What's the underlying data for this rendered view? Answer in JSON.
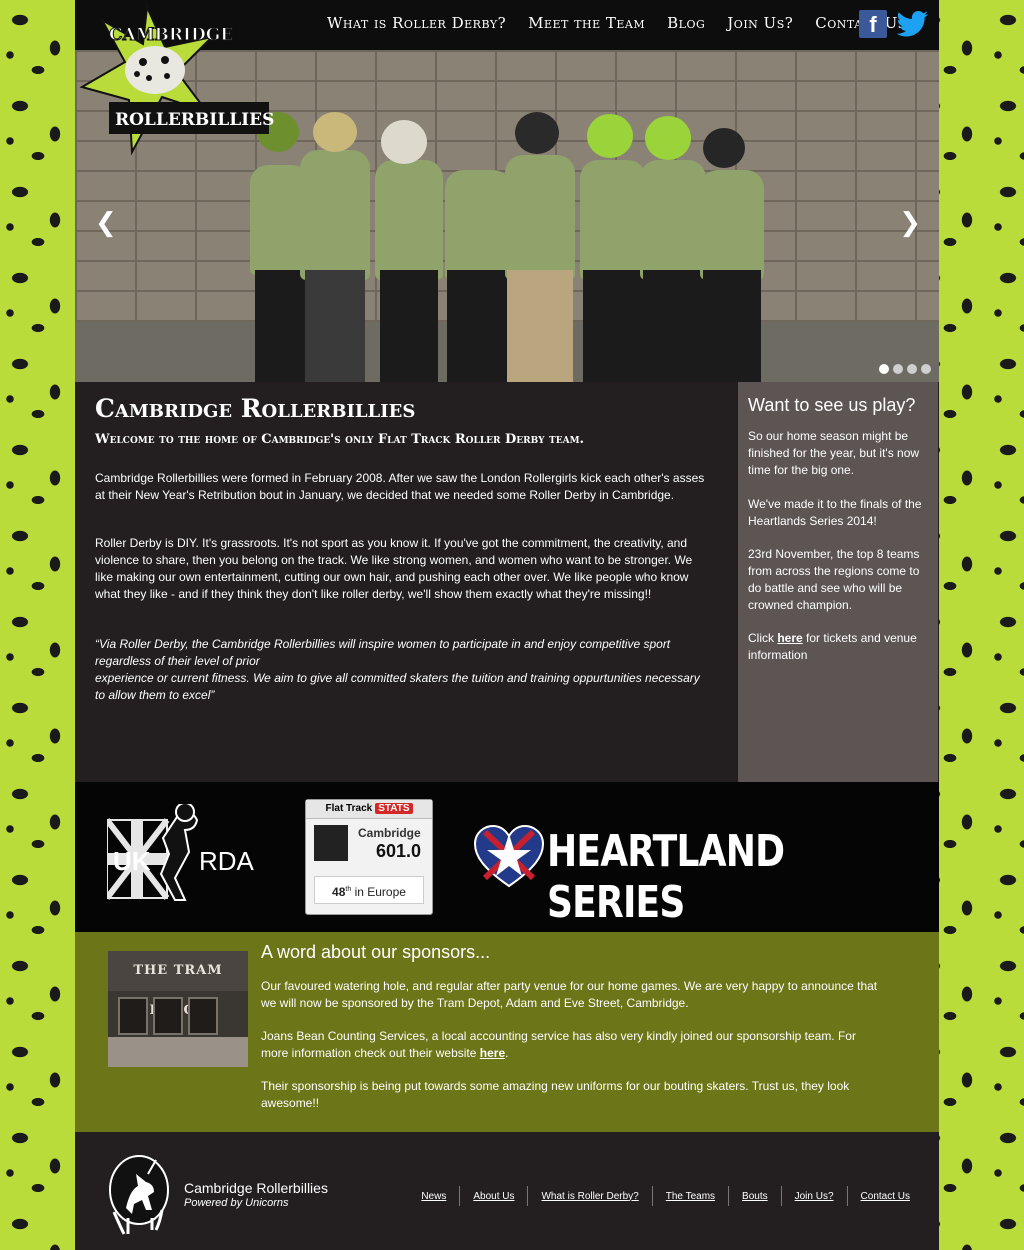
{
  "brand": {
    "logo_top": "CAMBRIDGE",
    "logo_bottom": "ROLLERBILLIES",
    "logo_alt": "Cambridge Rollerbillies logo"
  },
  "nav": {
    "items": [
      {
        "label": "What is Roller Derby?"
      },
      {
        "label": "Meet the Team"
      },
      {
        "label": "Blog"
      },
      {
        "label": "Join Us?"
      },
      {
        "label": "Contact Us"
      }
    ]
  },
  "social": {
    "facebook_icon": "facebook-icon",
    "twitter_icon": "twitter-icon"
  },
  "hero": {
    "prev_glyph": "❮",
    "next_glyph": "❯",
    "slide_count": 4,
    "active_slide": 1,
    "accent": "#9ad33a"
  },
  "main": {
    "title": "Cambridge Rollerbillies",
    "subtitle": "Welcome to the home of Cambridge's only Flat Track Roller Derby team.",
    "p1": "Cambridge Rollerbillies were formed in February 2008. After we saw the London Rollergirls kick each other's asses at their New Year's Retribution bout in January, we decided that we needed some Roller Derby in Cambridge.",
    "p2": "Roller Derby is DIY. It's grassroots. It's not sport as you know it. If you've got the commitment, the creativity, and violence to share, then you  belong on the track. We like strong women, and women who want to be stronger. We like making our own entertainment, cutting our own hair, and pushing each other over. We like people who know what they like - and if they think they don't like roller derby, we'll show them  exactly what they're missing!!",
    "quote_1": "“Via Roller Derby, the Cambridge Rollerbillies will inspire women to participate in and enjoy competitive sport regardless of their level of prior",
    "quote_2": "experience or current fitness. We aim to give all committed skaters the tuition and training oppurtunities necessary to allow them to excel”"
  },
  "aside": {
    "title": "Want to see us play?",
    "p1": "So our home season might be finished for the year, but it's now time for the big one.",
    "p2": "We've made it to the finals of the Heartlands Series 2014!",
    "p3": "23rd November, the top 8 teams from across the regions come to do battle and see who will be crowned champion.",
    "p4_pre": "Click ",
    "p4_link": "here",
    "p4_post": " for tickets and venue information"
  },
  "partners": {
    "ukrda_left": "UK",
    "ukrda_right": "RDA",
    "fts_label": "Flat Track",
    "fts_stats": "STATS",
    "fts_team": "Cambridge",
    "fts_score": "601.0",
    "fts_rank_num": "48",
    "fts_rank_sup": "th",
    "fts_rank_text": " in Europe",
    "heartland": "HEARTLAND SERIES"
  },
  "sponsors": {
    "title": "A word about our sponsors...",
    "image_sign": "THE TRAM DEPOT",
    "p1": "Our favoured watering hole, and regular after party venue for our home games. We are very happy to announce that we will now be sponsored by the Tram Depot, Adam and Eve Street, Cambridge.",
    "p2_pre": "Joans Bean Counting Services, a local accounting service has also very kindly joined our sponsorship team. For more information check out their website ",
    "p2_link": "here",
    "p2_post": ".",
    "p3": "Their sponsorship is being put towards some amazing new uniforms for our bouting skaters. Trust us, they look awesome!!"
  },
  "footer": {
    "name": "Cambridge Rollerbillies",
    "tagline": "Powered by Unicorns",
    "links": [
      {
        "label": "News"
      },
      {
        "label": "About Us"
      },
      {
        "label": "What is Roller Derby?"
      },
      {
        "label": "The Teams"
      },
      {
        "label": "Bouts"
      },
      {
        "label": "Join Us?"
      },
      {
        "label": "Contact Us"
      }
    ]
  }
}
